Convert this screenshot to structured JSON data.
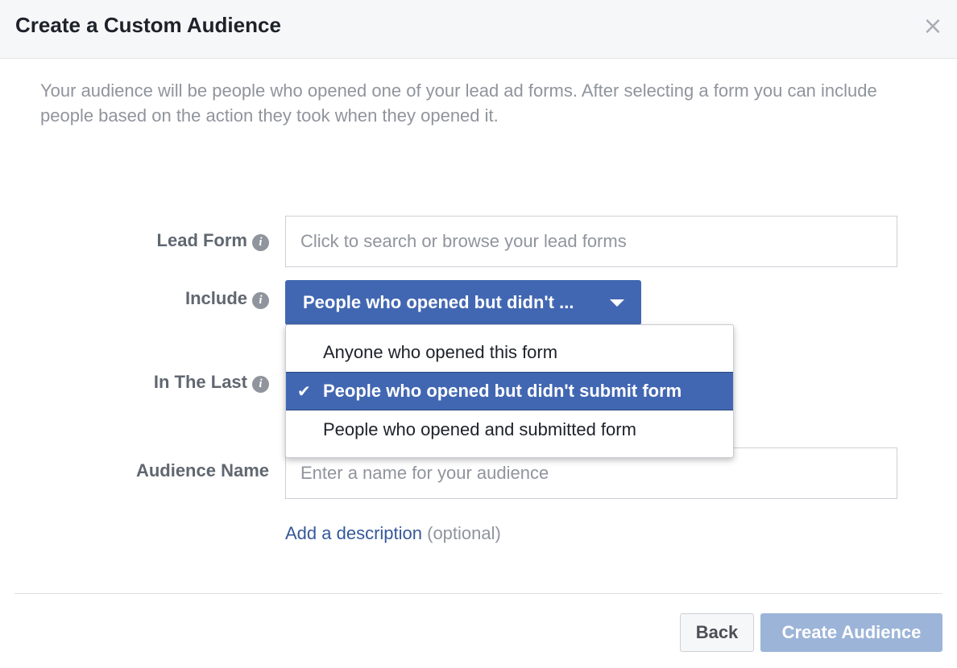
{
  "dialog": {
    "title": "Create a Custom Audience",
    "close_glyph": "×",
    "intro": "Your audience will be people who opened one of your lead ad forms. After selecting a form you can include people based on the action they took when they opened it."
  },
  "form": {
    "lead_form": {
      "label": "Lead Form",
      "placeholder": "Click to search or browse your lead forms",
      "value": ""
    },
    "include": {
      "label": "Include",
      "selected_display": "People who opened but didn't ...",
      "options": [
        {
          "label": "Anyone who opened this form",
          "selected": false
        },
        {
          "label": "People who opened but didn't submit form",
          "selected": true
        },
        {
          "label": "People who opened and submitted form",
          "selected": false
        }
      ]
    },
    "in_the_last": {
      "label": "In The Last"
    },
    "audience_name": {
      "label": "Audience Name",
      "placeholder": "Enter a name for your audience",
      "value": ""
    },
    "description": {
      "link_text": "Add a description",
      "optional_text": "(optional)"
    }
  },
  "footer": {
    "back_label": "Back",
    "create_label": "Create Audience"
  },
  "icons": {
    "info": "i",
    "check": "✔"
  },
  "colors": {
    "primary": "#4267b2",
    "primary_disabled": "#9cb4d8",
    "link": "#365899",
    "muted_text": "#90949c",
    "label_text": "#606770"
  }
}
